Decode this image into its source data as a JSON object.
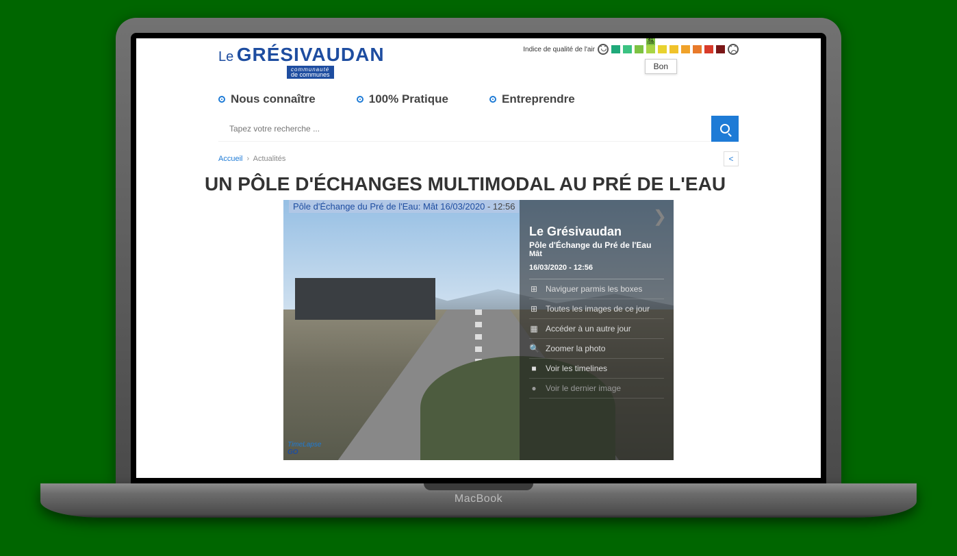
{
  "brand": "MacBook",
  "logo": {
    "prefix": "Le",
    "main": "GRÉSIVAUDAN",
    "sub_line1": "communauté",
    "sub_line2": "de communes"
  },
  "air": {
    "label": "Indice de qualité de l'air",
    "index_value": "41",
    "index_denom": "/100",
    "tooltip": "Bon",
    "colors": [
      "#1fa97a",
      "#3bc282",
      "#7dc242",
      "#a8d445",
      "#e8d22f",
      "#f0c22a",
      "#f0a22a",
      "#e87a2a",
      "#d83a2a",
      "#7a1616"
    ]
  },
  "nav": {
    "items": [
      "Nous connaître",
      "100% Pratique",
      "Entreprendre"
    ]
  },
  "search": {
    "placeholder": "Tapez votre recherche ..."
  },
  "breadcrumb": {
    "home": "Accueil",
    "current": "Actualités"
  },
  "title": "UN PÔLE D'ÉCHANGES MULTIMODAL AU PRÉ DE L'EAU",
  "widget": {
    "top_label": "Pôle d'Échange du Pré de l'Eau: Mât 16/03/2020",
    "top_time": "- 12:56",
    "panel_title": "Le Grésivaudan",
    "panel_sub1": "Pôle d'Échange du Pré de l'Eau",
    "panel_sub2": "Mât",
    "timestamp": "16/03/2020 - 12:56",
    "menu": [
      {
        "icon": "⊞",
        "label": "Naviguer parmis les boxes"
      },
      {
        "icon": "⊞",
        "label": "Toutes les images de ce jour"
      },
      {
        "icon": "▦",
        "label": "Accéder à un autre jour"
      },
      {
        "icon": "🔍",
        "label": "Zoomer la photo"
      },
      {
        "icon": "■",
        "label": "Voir les timelines"
      },
      {
        "icon": "●",
        "label": "Voir le dernier image"
      }
    ],
    "logo_1": "TimeLapse",
    "logo_2": "GO"
  }
}
